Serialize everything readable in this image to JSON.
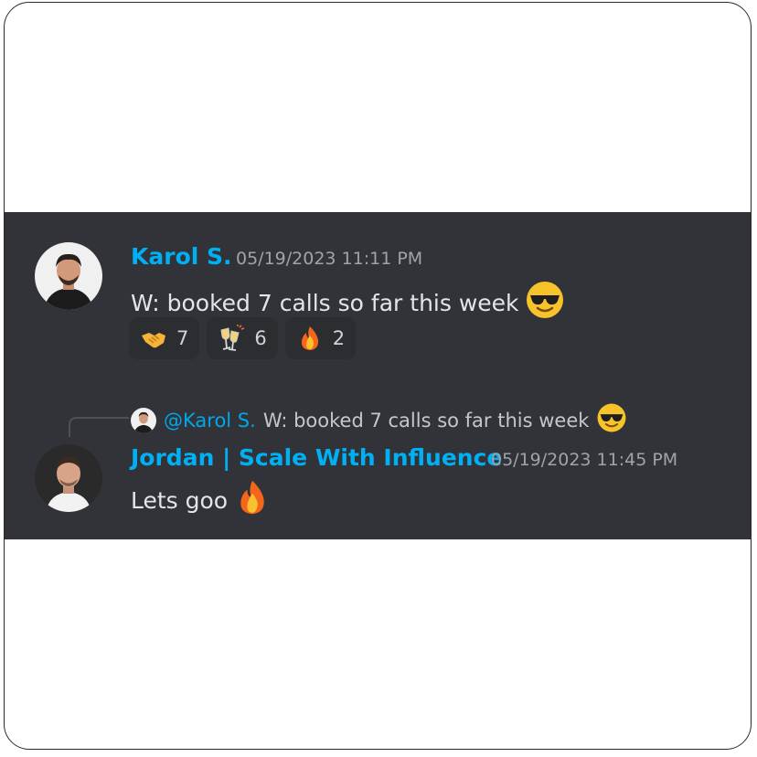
{
  "messages": [
    {
      "author": "Karol S.",
      "timestamp": "05/19/2023 11:11 PM",
      "text": "W: booked 7 calls so far this week",
      "emoji": "sunglasses-face",
      "reactions": [
        {
          "emoji": "handshake",
          "count": "7"
        },
        {
          "emoji": "clinking-glasses",
          "count": "6"
        },
        {
          "emoji": "fire",
          "count": "2"
        }
      ]
    },
    {
      "author": "Jordan | Scale With Influence",
      "timestamp": "05/19/2023 11:45 PM",
      "text": "Lets goo",
      "emoji": "fire",
      "reply_to": {
        "mention": "@Karol S.",
        "text": "W: booked 7 calls so far this week",
        "emoji": "sunglasses-face"
      }
    }
  ],
  "colors": {
    "panel_bg": "#313338",
    "username": "#00b0f4",
    "timestamp": "#a0a3a9",
    "message_text": "#e3e5e8",
    "reaction_bg": "#2b2d31"
  }
}
